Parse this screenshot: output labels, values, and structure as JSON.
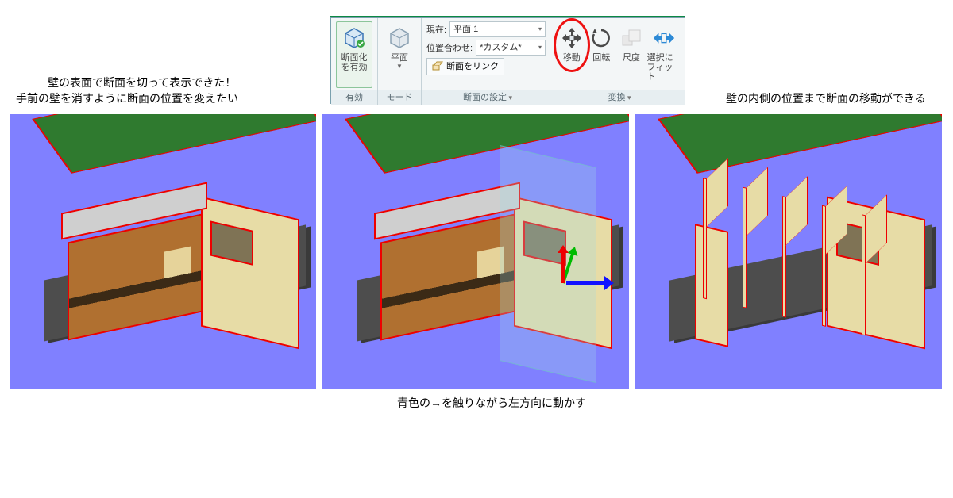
{
  "ribbon": {
    "groups": {
      "enable": "有効",
      "mode": "モード",
      "settings": "断面の設定",
      "transform": "変換"
    },
    "buttons": {
      "sectioning": "断面化\nを有効",
      "plane": "平面",
      "move": "移動",
      "rotate": "回転",
      "scale": "尺度",
      "fit": "選択に\nフィット"
    },
    "settings": {
      "current_label": "現在:",
      "current_value": "平面 1",
      "align_label": "位置合わせ:",
      "align_value": "*カスタム*",
      "link_section": "断面をリンク"
    }
  },
  "captions": {
    "left_a": "壁の表面で断面を切って表示できた！",
    "left_b": "手前の壁を消すように断面の位置を変えたい",
    "right_a": "壁の内側の位置まで断面の移動ができる",
    "mid_below": "青色の→を触りながら左方向に動かす"
  }
}
